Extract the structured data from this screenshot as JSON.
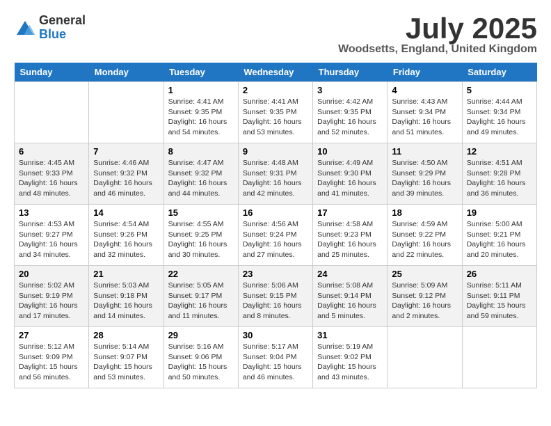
{
  "logo": {
    "general": "General",
    "blue": "Blue"
  },
  "header": {
    "title": "July 2025",
    "subtitle": "Woodsetts, England, United Kingdom"
  },
  "weekdays": [
    "Sunday",
    "Monday",
    "Tuesday",
    "Wednesday",
    "Thursday",
    "Friday",
    "Saturday"
  ],
  "weeks": [
    [
      {
        "day": "",
        "sunrise": "",
        "sunset": "",
        "daylight": ""
      },
      {
        "day": "",
        "sunrise": "",
        "sunset": "",
        "daylight": ""
      },
      {
        "day": "1",
        "sunrise": "Sunrise: 4:41 AM",
        "sunset": "Sunset: 9:35 PM",
        "daylight": "Daylight: 16 hours and 54 minutes."
      },
      {
        "day": "2",
        "sunrise": "Sunrise: 4:41 AM",
        "sunset": "Sunset: 9:35 PM",
        "daylight": "Daylight: 16 hours and 53 minutes."
      },
      {
        "day": "3",
        "sunrise": "Sunrise: 4:42 AM",
        "sunset": "Sunset: 9:35 PM",
        "daylight": "Daylight: 16 hours and 52 minutes."
      },
      {
        "day": "4",
        "sunrise": "Sunrise: 4:43 AM",
        "sunset": "Sunset: 9:34 PM",
        "daylight": "Daylight: 16 hours and 51 minutes."
      },
      {
        "day": "5",
        "sunrise": "Sunrise: 4:44 AM",
        "sunset": "Sunset: 9:34 PM",
        "daylight": "Daylight: 16 hours and 49 minutes."
      }
    ],
    [
      {
        "day": "6",
        "sunrise": "Sunrise: 4:45 AM",
        "sunset": "Sunset: 9:33 PM",
        "daylight": "Daylight: 16 hours and 48 minutes."
      },
      {
        "day": "7",
        "sunrise": "Sunrise: 4:46 AM",
        "sunset": "Sunset: 9:32 PM",
        "daylight": "Daylight: 16 hours and 46 minutes."
      },
      {
        "day": "8",
        "sunrise": "Sunrise: 4:47 AM",
        "sunset": "Sunset: 9:32 PM",
        "daylight": "Daylight: 16 hours and 44 minutes."
      },
      {
        "day": "9",
        "sunrise": "Sunrise: 4:48 AM",
        "sunset": "Sunset: 9:31 PM",
        "daylight": "Daylight: 16 hours and 42 minutes."
      },
      {
        "day": "10",
        "sunrise": "Sunrise: 4:49 AM",
        "sunset": "Sunset: 9:30 PM",
        "daylight": "Daylight: 16 hours and 41 minutes."
      },
      {
        "day": "11",
        "sunrise": "Sunrise: 4:50 AM",
        "sunset": "Sunset: 9:29 PM",
        "daylight": "Daylight: 16 hours and 39 minutes."
      },
      {
        "day": "12",
        "sunrise": "Sunrise: 4:51 AM",
        "sunset": "Sunset: 9:28 PM",
        "daylight": "Daylight: 16 hours and 36 minutes."
      }
    ],
    [
      {
        "day": "13",
        "sunrise": "Sunrise: 4:53 AM",
        "sunset": "Sunset: 9:27 PM",
        "daylight": "Daylight: 16 hours and 34 minutes."
      },
      {
        "day": "14",
        "sunrise": "Sunrise: 4:54 AM",
        "sunset": "Sunset: 9:26 PM",
        "daylight": "Daylight: 16 hours and 32 minutes."
      },
      {
        "day": "15",
        "sunrise": "Sunrise: 4:55 AM",
        "sunset": "Sunset: 9:25 PM",
        "daylight": "Daylight: 16 hours and 30 minutes."
      },
      {
        "day": "16",
        "sunrise": "Sunrise: 4:56 AM",
        "sunset": "Sunset: 9:24 PM",
        "daylight": "Daylight: 16 hours and 27 minutes."
      },
      {
        "day": "17",
        "sunrise": "Sunrise: 4:58 AM",
        "sunset": "Sunset: 9:23 PM",
        "daylight": "Daylight: 16 hours and 25 minutes."
      },
      {
        "day": "18",
        "sunrise": "Sunrise: 4:59 AM",
        "sunset": "Sunset: 9:22 PM",
        "daylight": "Daylight: 16 hours and 22 minutes."
      },
      {
        "day": "19",
        "sunrise": "Sunrise: 5:00 AM",
        "sunset": "Sunset: 9:21 PM",
        "daylight": "Daylight: 16 hours and 20 minutes."
      }
    ],
    [
      {
        "day": "20",
        "sunrise": "Sunrise: 5:02 AM",
        "sunset": "Sunset: 9:19 PM",
        "daylight": "Daylight: 16 hours and 17 minutes."
      },
      {
        "day": "21",
        "sunrise": "Sunrise: 5:03 AM",
        "sunset": "Sunset: 9:18 PM",
        "daylight": "Daylight: 16 hours and 14 minutes."
      },
      {
        "day": "22",
        "sunrise": "Sunrise: 5:05 AM",
        "sunset": "Sunset: 9:17 PM",
        "daylight": "Daylight: 16 hours and 11 minutes."
      },
      {
        "day": "23",
        "sunrise": "Sunrise: 5:06 AM",
        "sunset": "Sunset: 9:15 PM",
        "daylight": "Daylight: 16 hours and 8 minutes."
      },
      {
        "day": "24",
        "sunrise": "Sunrise: 5:08 AM",
        "sunset": "Sunset: 9:14 PM",
        "daylight": "Daylight: 16 hours and 5 minutes."
      },
      {
        "day": "25",
        "sunrise": "Sunrise: 5:09 AM",
        "sunset": "Sunset: 9:12 PM",
        "daylight": "Daylight: 16 hours and 2 minutes."
      },
      {
        "day": "26",
        "sunrise": "Sunrise: 5:11 AM",
        "sunset": "Sunset: 9:11 PM",
        "daylight": "Daylight: 15 hours and 59 minutes."
      }
    ],
    [
      {
        "day": "27",
        "sunrise": "Sunrise: 5:12 AM",
        "sunset": "Sunset: 9:09 PM",
        "daylight": "Daylight: 15 hours and 56 minutes."
      },
      {
        "day": "28",
        "sunrise": "Sunrise: 5:14 AM",
        "sunset": "Sunset: 9:07 PM",
        "daylight": "Daylight: 15 hours and 53 minutes."
      },
      {
        "day": "29",
        "sunrise": "Sunrise: 5:16 AM",
        "sunset": "Sunset: 9:06 PM",
        "daylight": "Daylight: 15 hours and 50 minutes."
      },
      {
        "day": "30",
        "sunrise": "Sunrise: 5:17 AM",
        "sunset": "Sunset: 9:04 PM",
        "daylight": "Daylight: 15 hours and 46 minutes."
      },
      {
        "day": "31",
        "sunrise": "Sunrise: 5:19 AM",
        "sunset": "Sunset: 9:02 PM",
        "daylight": "Daylight: 15 hours and 43 minutes."
      },
      {
        "day": "",
        "sunrise": "",
        "sunset": "",
        "daylight": ""
      },
      {
        "day": "",
        "sunrise": "",
        "sunset": "",
        "daylight": ""
      }
    ]
  ]
}
